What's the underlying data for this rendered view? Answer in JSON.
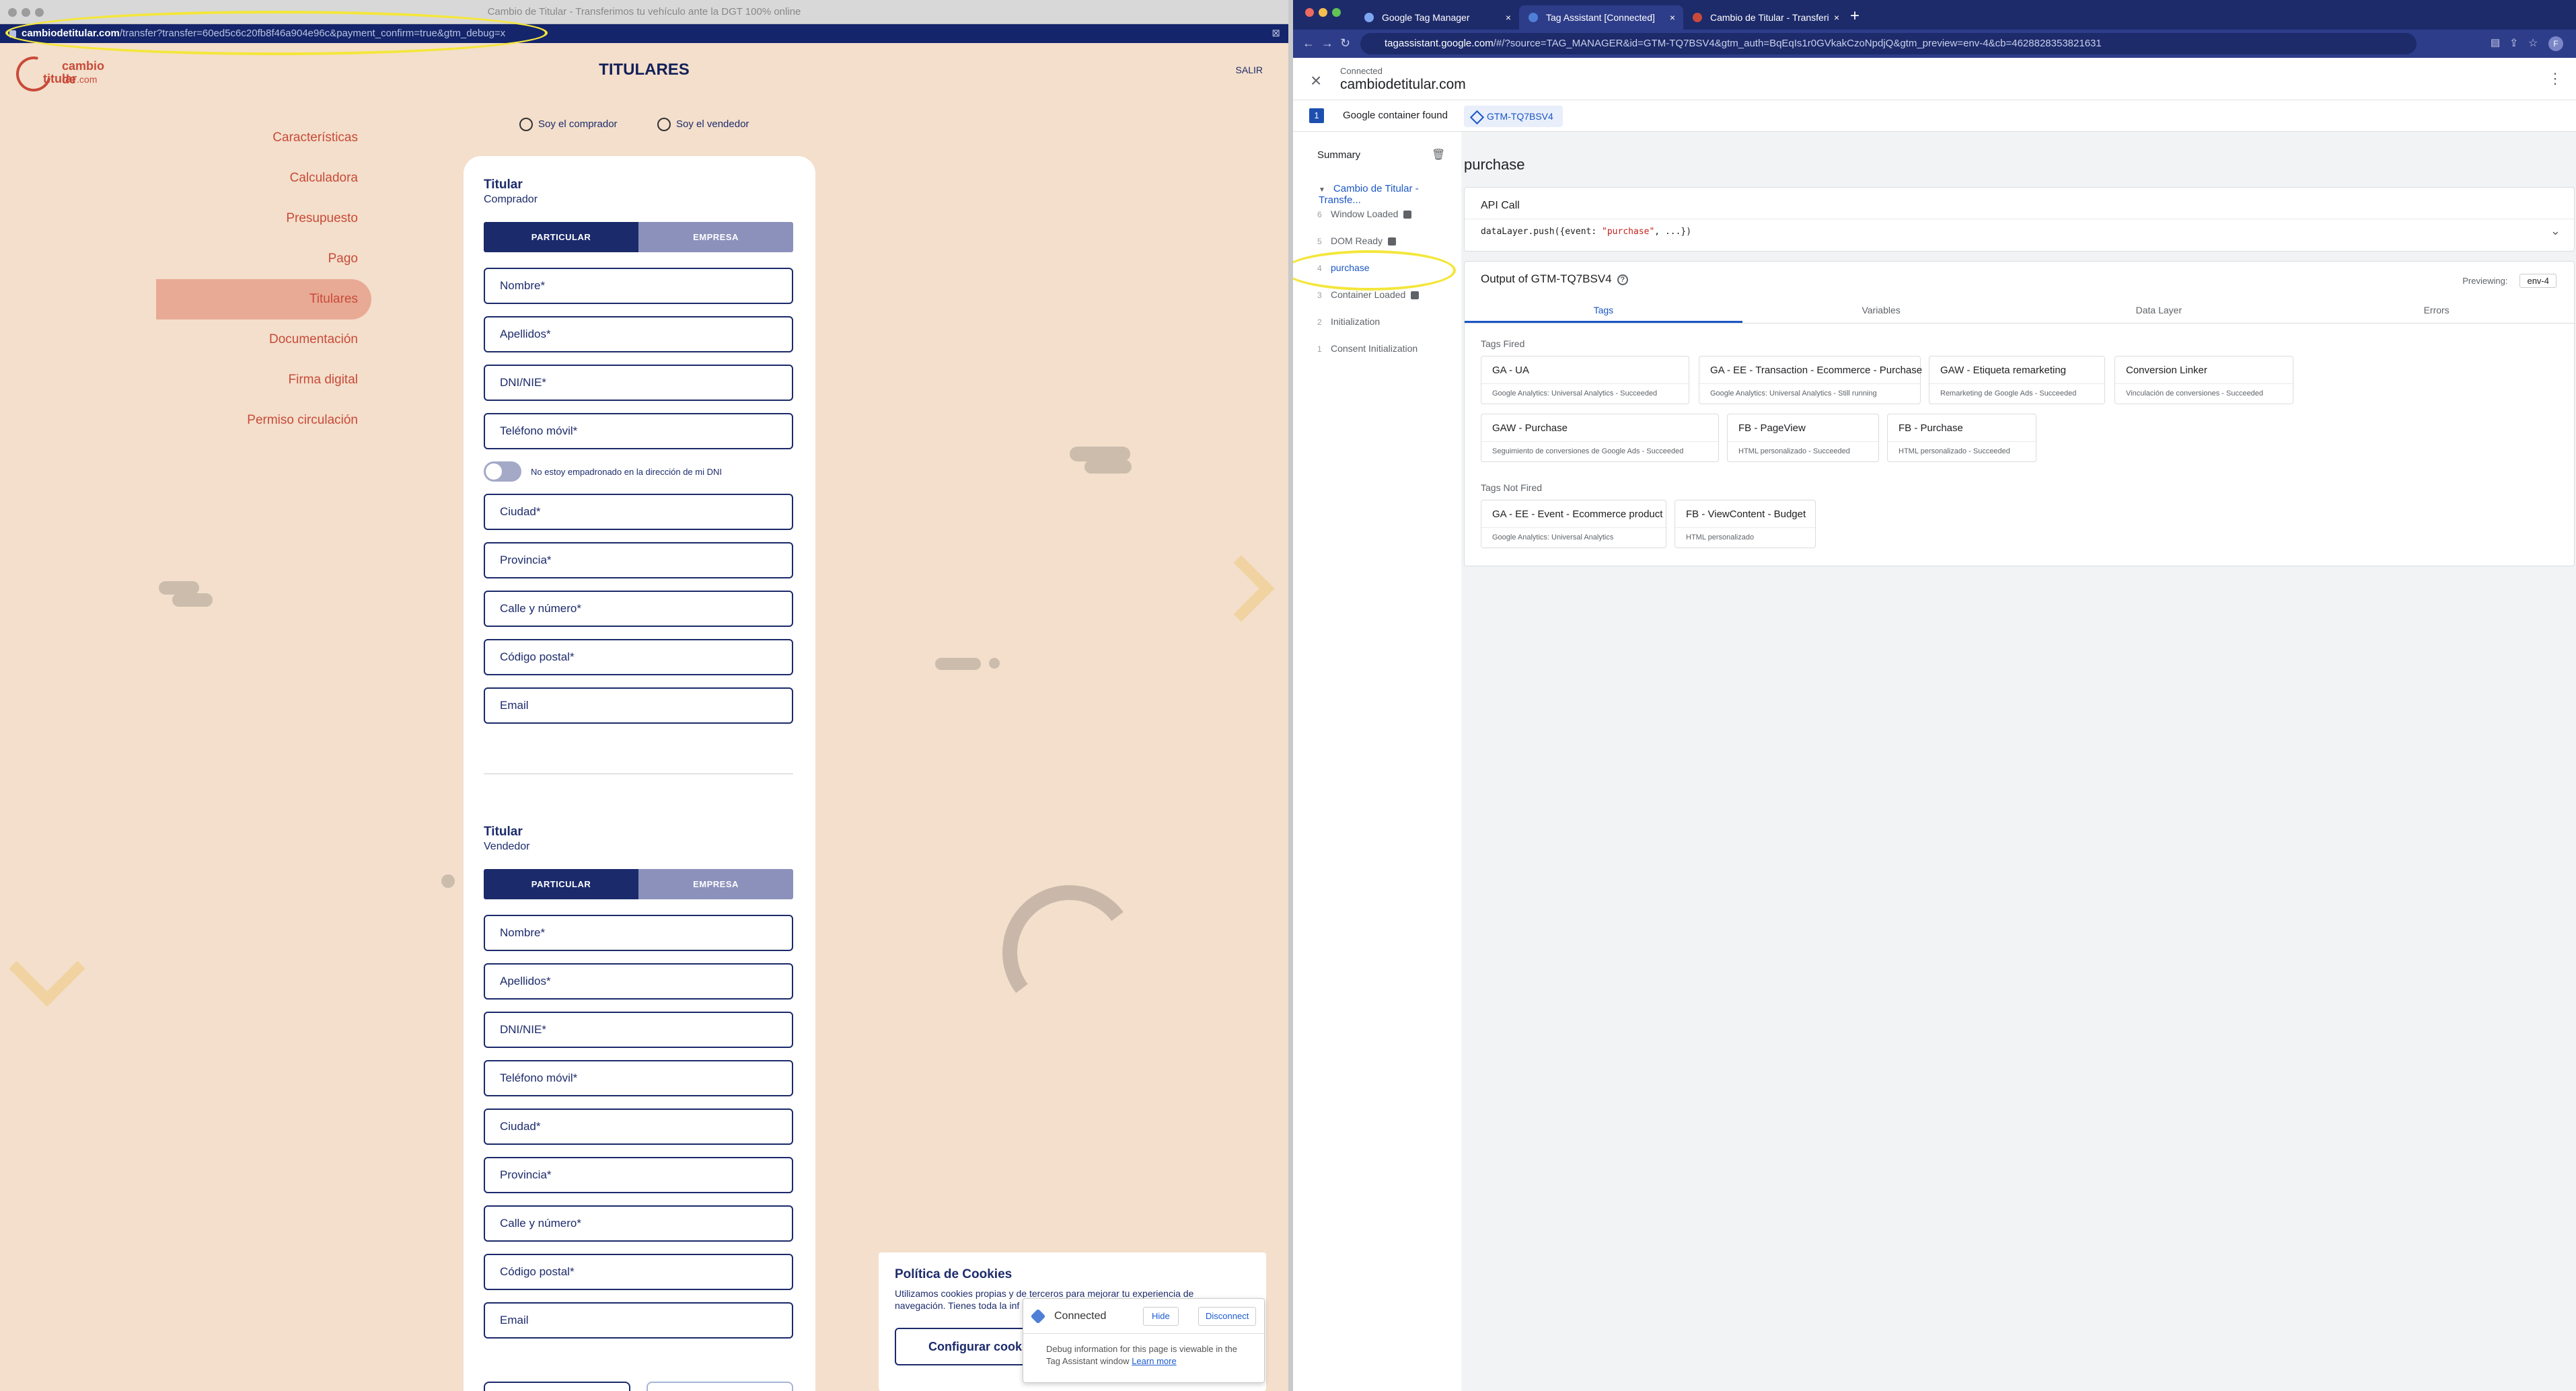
{
  "left": {
    "window_title": "Cambio de Titular - Transferimos tu vehículo ante la DGT 100% online",
    "url_domain": "cambiodetitular.com",
    "url_path": "/transfer?transfer=60ed5c6c20fb8f46a904e96c&payment_confirm=true&gtm_debug=x",
    "logo_line1": "cambio de",
    "logo_line2": "titular",
    "logo_tld": ".com",
    "page_title": "TITULARES",
    "logout": "SALIR",
    "nav": [
      "Características",
      "Calculadora",
      "Presupuesto",
      "Pago",
      "Titulares",
      "Documentación",
      "Firma digital",
      "Permiso circulación"
    ],
    "role_buyer": "Soy el comprador",
    "role_seller": "Soy el vendedor",
    "buyer": {
      "title": "Titular",
      "subtitle": "Comprador",
      "tab_a": "PARTICULAR",
      "tab_b": "EMPRESA",
      "fields": [
        "Nombre*",
        "Apellidos*",
        "DNI/NIE*",
        "Teléfono móvil*"
      ],
      "toggle_label": "No estoy empadronado en la dirección de mi DNI",
      "fields2": [
        "Ciudad*",
        "Provincia*",
        "Calle y número*",
        "Código postal*",
        "Email"
      ]
    },
    "seller": {
      "title": "Titular",
      "subtitle": "Vendedor",
      "tab_a": "PARTICULAR",
      "tab_b": "EMPRESA",
      "fields": [
        "Nombre*",
        "Apellidos*",
        "DNI/NIE*",
        "Teléfono móvil*",
        "Ciudad*",
        "Provincia*",
        "Calle y número*",
        "Código postal*",
        "Email"
      ]
    },
    "cookies": {
      "title": "Política de Cookies",
      "text": "Utilizamos cookies propias y de terceros para mejorar tu experiencia de navegación. Tienes toda la inf",
      "button": "Configurar cookie"
    },
    "debug": {
      "status": "Connected",
      "hide": "Hide",
      "disconnect": "Disconnect",
      "text": "Debug information for this page is viewable in the Tag Assistant window",
      "link": "Learn more"
    }
  },
  "right": {
    "tabs": [
      {
        "label": "Google Tag Manager"
      },
      {
        "label": "Tag Assistant [Connected]"
      },
      {
        "label": "Cambio de Titular - Transferi"
      }
    ],
    "url_domain": "tagassistant.google.com",
    "url_rest": "/#/?source=TAG_MANAGER&id=GTM-TQ7BSV4&gtm_auth=BqEqIs1r0GVkakCzoNpdjQ&gtm_preview=env-4&cb=4628828353821631",
    "profile": "F",
    "connected": "Connected",
    "domain": "cambiodetitular.com",
    "container_count": "1",
    "container_found": "Google container found",
    "container_id": "GTM-TQ7BSV4",
    "summary": "Summary",
    "page_item": "Cambio de Titular - Transfe...",
    "events": [
      {
        "n": "6",
        "label": "Window Loaded"
      },
      {
        "n": "5",
        "label": "DOM Ready"
      },
      {
        "n": "4",
        "label": "purchase"
      },
      {
        "n": "3",
        "label": "Container Loaded"
      },
      {
        "n": "2",
        "label": "Initialization"
      },
      {
        "n": "1",
        "label": "Consent Initialization"
      }
    ],
    "event_heading": "purchase",
    "api_call": "API Call",
    "code_pre": "dataLayer.push({event: ",
    "code_str": "\"purchase\"",
    "code_post": ", ...})",
    "output_title": "Output of GTM-TQ7BSV4",
    "previewing_label": "Previewing:",
    "previewing_value": "env-4",
    "output_tabs": [
      "Tags",
      "Variables",
      "Data Layer",
      "Errors"
    ],
    "tags_fired_label": "Tags Fired",
    "tags_fired": [
      {
        "name": "GA - UA",
        "status": "Google Analytics: Universal Analytics - Succeeded"
      },
      {
        "name": "GA - EE - Transaction - Ecommerce - Purchase",
        "status": "Google Analytics: Universal Analytics - Still running"
      },
      {
        "name": "GAW - Etiqueta remarketing",
        "status": "Remarketing de Google Ads - Succeeded"
      },
      {
        "name": "Conversion Linker",
        "status": "Vinculación de conversiones - Succeeded"
      },
      {
        "name": "GAW - Purchase",
        "status": "Seguimiento de conversiones de Google Ads - Succeeded"
      },
      {
        "name": "FB - PageView",
        "status": "HTML personalizado - Succeeded"
      },
      {
        "name": "FB - Purchase",
        "status": "HTML personalizado - Succeeded"
      }
    ],
    "tags_not_fired_label": "Tags Not Fired",
    "tags_not_fired": [
      {
        "name": "GA - EE - Event - Ecommerce product",
        "status": "Google Analytics: Universal Analytics"
      },
      {
        "name": "FB - ViewContent - Budget",
        "status": "HTML personalizado"
      }
    ]
  },
  "colors": {
    "brand_red": "#c94a3a",
    "navy": "#1b2a6b",
    "highlight": "#f4e63a",
    "link_blue": "#1a56c4"
  }
}
